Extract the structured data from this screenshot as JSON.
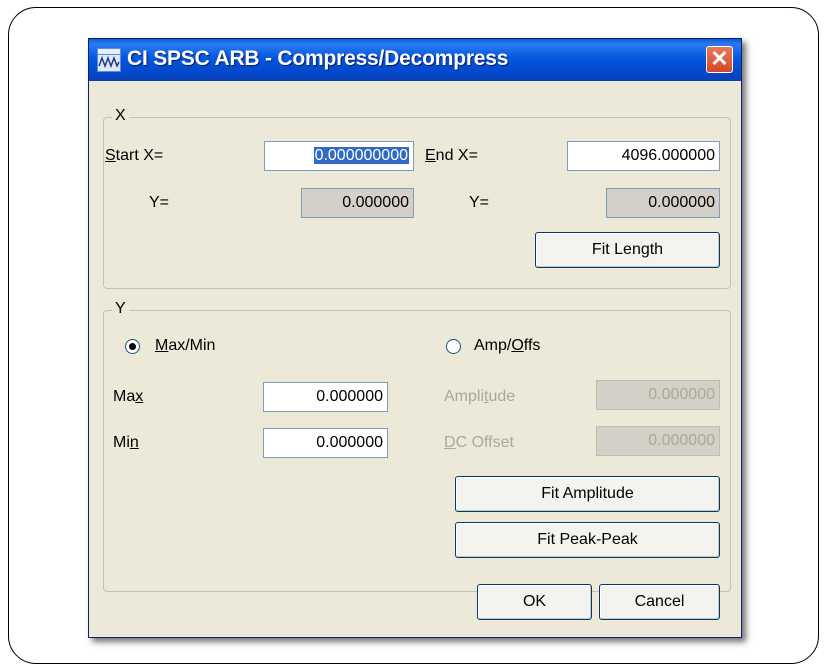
{
  "window": {
    "title": "CI SPSC ARB - Compress/Decompress",
    "close_label": "✕"
  },
  "x_group": {
    "label": "X",
    "start_label": [
      "S",
      "tart X="
    ],
    "start_x_value": "0.000000000",
    "end_label": [
      "E",
      "nd  X="
    ],
    "end_x_value": "4096.000000",
    "start_y_label": "Y=",
    "start_y_value": "0.000000",
    "end_y_label": "Y=",
    "end_y_value": "0.000000",
    "fit_length_label": "Fit Length"
  },
  "y_group": {
    "label": "Y",
    "maxmin_radio": [
      "M",
      "ax/Min"
    ],
    "ampoffs_radio": [
      "Amp/",
      "O",
      "ffs"
    ],
    "max_label": [
      "Ma",
      "x"
    ],
    "max_value": "0.000000",
    "min_label": [
      "Mi",
      "n"
    ],
    "min_value": "0.000000",
    "amplitude_label": [
      "Ampli",
      "t",
      "ude"
    ],
    "amplitude_value": "0.000000",
    "dcoffset_label": [
      "D",
      "C Offset"
    ],
    "dcoffset_value": "0.000000",
    "fit_amplitude_label": "Fit Amplitude",
    "fit_peakpeak_label": "Fit Peak-Peak",
    "selected_mode": "Max/Min"
  },
  "footer": {
    "ok_label": "OK",
    "cancel_label": "Cancel"
  },
  "colors": {
    "titlebar": "#0557e0",
    "dialog_bg": "#ece9d8",
    "selection": "#316ac5"
  }
}
